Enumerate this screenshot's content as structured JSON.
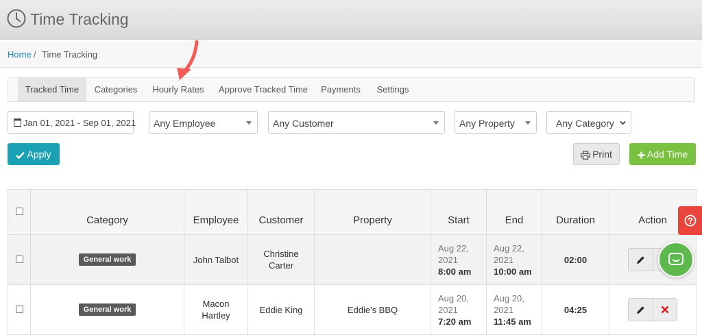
{
  "header": {
    "title": "Time Tracking",
    "icon": "clock-icon"
  },
  "breadcrumb": {
    "home": "Home",
    "separator": "/",
    "current": "Time Tracking"
  },
  "tabs": [
    {
      "label": "Tracked Time",
      "active": true
    },
    {
      "label": "Categories"
    },
    {
      "label": "Hourly Rates"
    },
    {
      "label": "Approve Tracked Time"
    },
    {
      "label": "Payments"
    },
    {
      "label": "Settings"
    }
  ],
  "filters": {
    "date_range": "Jan 01, 2021 - Sep 01, 2021",
    "employee": "Any Employee",
    "customer": "Any Customer",
    "property": "Any Property",
    "category": "Any Category"
  },
  "buttons": {
    "apply": "Apply",
    "print": "Print",
    "add_time": "Add Time"
  },
  "table": {
    "headers": [
      "Category",
      "Employee",
      "Customer",
      "Property",
      "Start",
      "End",
      "Duration",
      "Action"
    ],
    "rows": [
      {
        "category": "General work",
        "employee": [
          "John Talbot"
        ],
        "customer": [
          "Christine",
          "Carter"
        ],
        "property": "",
        "start": {
          "date1": "Aug 22,",
          "date2": "2021",
          "time": "8:00 am"
        },
        "end": {
          "date1": "Aug 22,",
          "date2": "2021",
          "time": "10:00 am"
        },
        "duration": "02:00"
      },
      {
        "category": "General work",
        "employee": [
          "Macon",
          "Hartley"
        ],
        "customer": [
          "Eddie King"
        ],
        "property": "Eddie's BBQ",
        "start": {
          "date1": "Aug 20,",
          "date2": "2021",
          "time": "7:20 am"
        },
        "end": {
          "date1": "Aug 20,",
          "date2": "2021",
          "time": "11:45 am"
        },
        "duration": "04:25"
      }
    ]
  },
  "colors": {
    "accent": "#1aa1b3",
    "add_button": "#7ac142",
    "help_button": "#e9453d",
    "chat_button": "#5db94e",
    "annotation_arrow": "#f25c54",
    "delete_icon": "#e02020"
  }
}
